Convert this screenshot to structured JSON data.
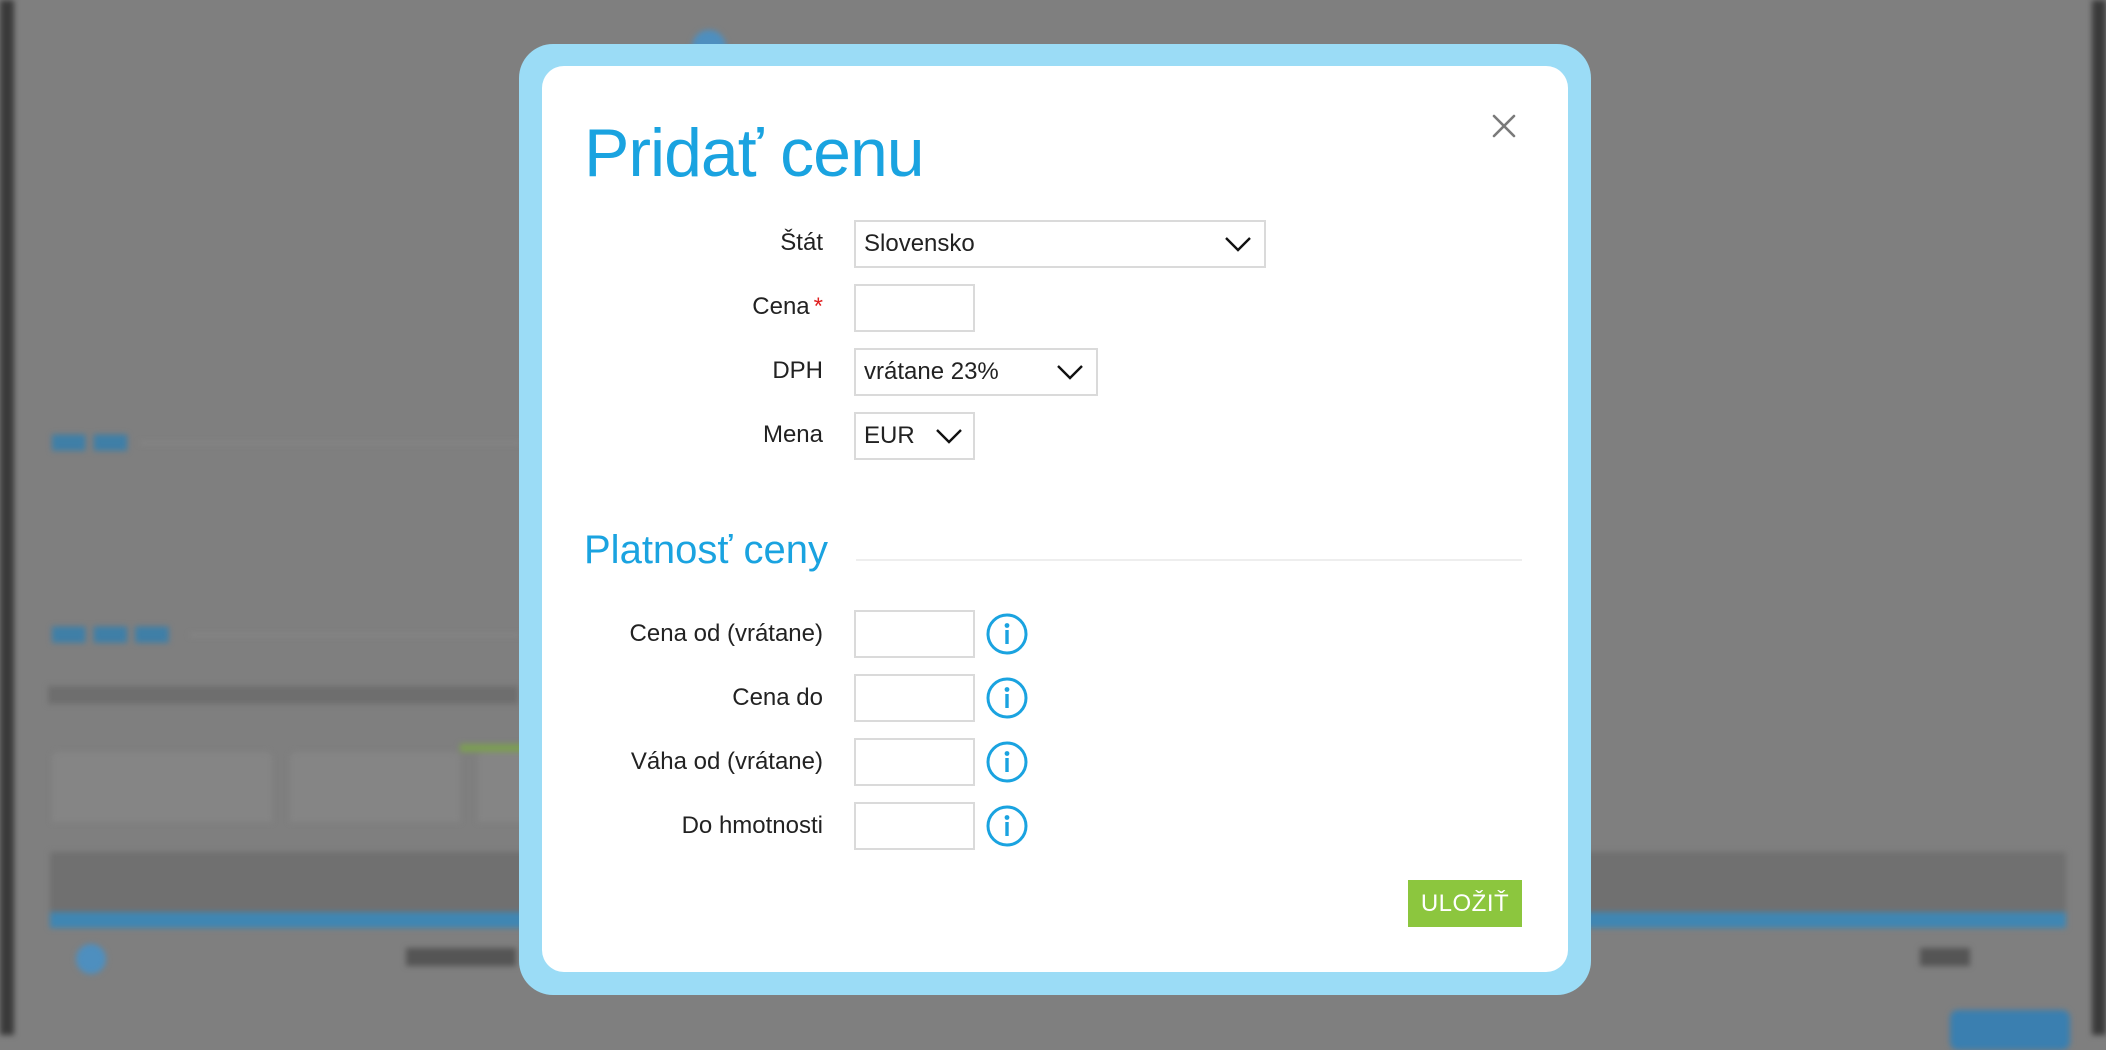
{
  "modal": {
    "title": "Pridať cenu",
    "fields": {
      "country": {
        "label": "Štát",
        "value": "Slovensko"
      },
      "price": {
        "label": "Cena",
        "required_mark": "*",
        "value": ""
      },
      "vat": {
        "label": "DPH",
        "value": "vrátane 23%"
      },
      "currency": {
        "label": "Mena",
        "value": "EUR"
      }
    },
    "validity_section": {
      "title": "Platnosť ceny",
      "fields": {
        "price_from": {
          "label": "Cena od (vrátane)",
          "value": ""
        },
        "price_to": {
          "label": "Cena do",
          "value": ""
        },
        "weight_from": {
          "label": "Váha od (vrátane)",
          "value": ""
        },
        "weight_to": {
          "label": "Do hmotnosti",
          "value": ""
        }
      }
    },
    "save_label": "ULOŽIŤ"
  },
  "icons": {
    "close": "close-icon",
    "dropdown": "chevron-down-icon",
    "info": "info-icon"
  },
  "colors": {
    "accent": "#1aa3e0",
    "modal_border": "#9bdcf6",
    "save_button": "#8cc63e",
    "required": "#e02020"
  }
}
